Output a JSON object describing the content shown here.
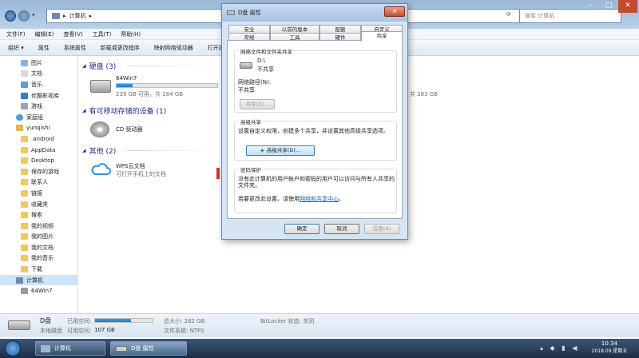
{
  "explorer": {
    "address_text": "计算机",
    "search_placeholder": "搜索 计算机",
    "menu": [
      "文件(F)",
      "编辑(E)",
      "查看(V)",
      "工具(T)",
      "帮助(H)"
    ],
    "toolbar": [
      "组织 ▾",
      "属性",
      "系统属性",
      "卸载或更改程序",
      "映射网络驱动器",
      "打开控制面板"
    ],
    "sidebar": [
      "图片",
      "文档",
      "音乐",
      "优酷影视库",
      "游戏",
      "家庭组",
      "yunqishi",
      ".android",
      "AppData",
      "Desktop",
      "保存的游戏",
      "联系人",
      "链接",
      "收藏夹",
      "搜索",
      "我的视频",
      "我的图片",
      "我的文档",
      "我的音乐",
      "下载",
      "计算机",
      "64Win7"
    ],
    "groups": {
      "hdd": "硬盘 (3)",
      "removable": "有可移动存储的设备 (1)",
      "other": "其他 (2)"
    },
    "drive_64win7": {
      "name": "64Win7",
      "detail": "239 GB 可用，共 284 GB",
      "used_fraction": 0.16
    },
    "drive_right_detail": "共 283 GB",
    "cd_label": "CD 驱动器",
    "wps": {
      "name": "WPS云文档",
      "detail": "可打开手机上的文档"
    },
    "status": {
      "drive_name": "D盘",
      "drive_type": "本地磁盘",
      "used_label": "已用空间:",
      "free_label": "可用空间:",
      "free_value": "107 GB",
      "total_label": "总大小: 282 GB",
      "fs_label": "文件系统: NTFS",
      "bitlocker": "BitLocker 状态: 关闭",
      "used_fraction": 0.62
    }
  },
  "dialog": {
    "title": "D盘 属性",
    "tabs_row1": [
      "安全",
      "以前的版本",
      "配额",
      "自定义"
    ],
    "tabs_row2": [
      "常规",
      "工具",
      "硬件",
      "共享"
    ],
    "net_share_title": "网络文件和文件夹共享",
    "share_drive": "D:\\",
    "share_state": "不共享",
    "net_path_label": "网络路径(N):",
    "net_path_value": "不共享",
    "share_button": "共享(S)...",
    "advanced_title": "高级共享",
    "advanced_desc": "设置自定义权限，创建多个共享，并设置其他高级共享选项。",
    "advanced_button": "高级共享(D)...",
    "pw_title": "密码保护",
    "pw_desc": "没有此计算机的用户帐户和密码的用户可以访问与所有人共享的文件夹。",
    "pw_change_prefix": "若要更改此设置，请使用",
    "pw_link": "网络和共享中心",
    "pw_change_suffix": "。",
    "ok": "确定",
    "cancel": "取消",
    "apply": "应用(A)"
  },
  "taskbar": {
    "items": [
      "计算机",
      "D盘 属性"
    ],
    "time": "10:34",
    "date": "2018.09.星期五"
  }
}
